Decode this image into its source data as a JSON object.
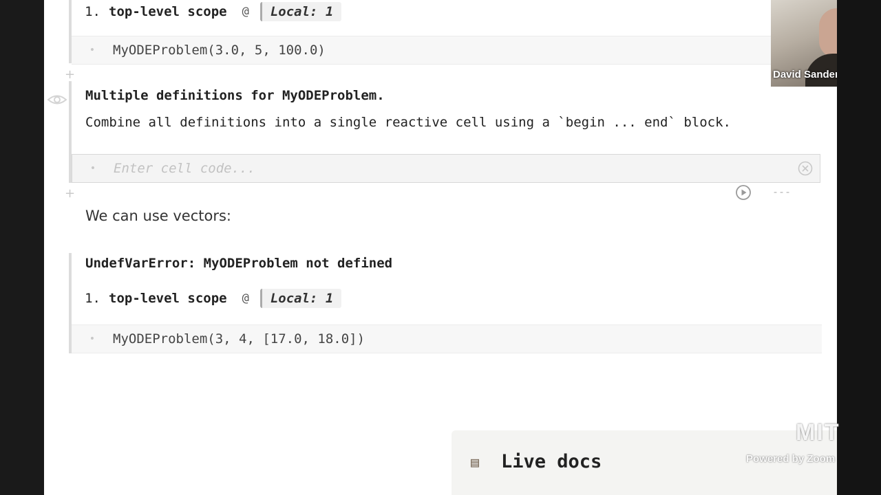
{
  "cell1": {
    "stack": {
      "num": "1.",
      "fn": "top-level scope",
      "at": "@",
      "loc": "Local: 1"
    },
    "code": "MyODEProblem(3.0, 5, 100.0)"
  },
  "cell2": {
    "error_title": "Multiple definitions for MyODEProblem.",
    "error_body": "Combine all definitions into a single reactive cell using a `begin ... end` block.",
    "placeholder": "Enter cell code...",
    "run_controls": "---"
  },
  "markdown": {
    "text": "We can use vectors:"
  },
  "cell3": {
    "error_title": "UndefVarError: MyODEProblem not defined",
    "stack": {
      "num": "1.",
      "fn": "top-level scope",
      "at": "@",
      "loc": "Local: 1"
    },
    "code": "MyODEProblem(3, 4, [17.0, 18.0])"
  },
  "live_docs": {
    "label": "Live docs"
  },
  "video": {
    "participant_name": "David Sander..."
  },
  "watermark": {
    "brand": "MIT",
    "powered": "Powered by Zoom"
  },
  "icons": {
    "add": "+",
    "eye": "eye-icon",
    "clear": "clear-icon",
    "run": "run-icon",
    "docs": "books-icon"
  }
}
